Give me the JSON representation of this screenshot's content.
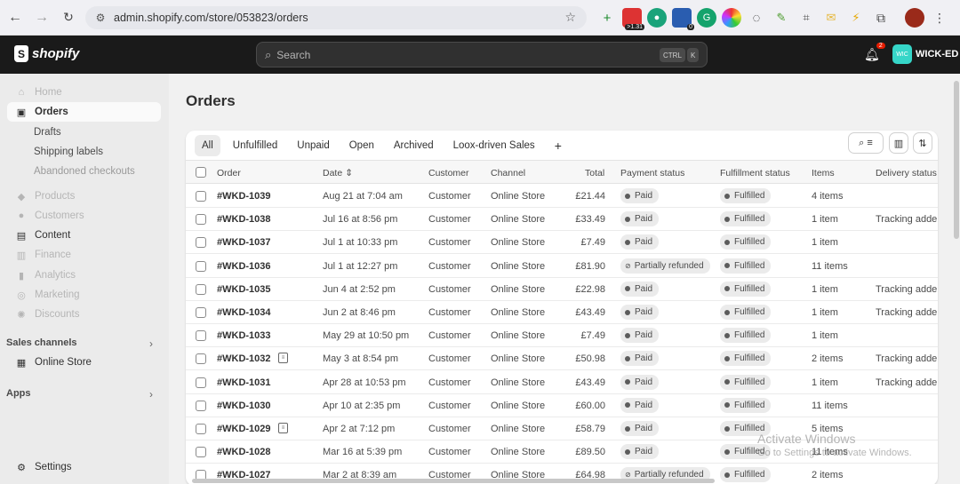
{
  "browser": {
    "url": "admin.shopify.com/store/053823/orders",
    "ext_badge_1": ">1.31",
    "ext_badge_2": "0"
  },
  "topbar": {
    "brand": "shopify",
    "search_placeholder": "Search",
    "kbd_ctrl": "CTRL",
    "kbd_k": "K",
    "notification_count": "2",
    "store_initials": "WIC",
    "store_name": "WICK-ED"
  },
  "sidebar": {
    "home": "Home",
    "orders": "Orders",
    "drafts": "Drafts",
    "shipping_labels": "Shipping labels",
    "abandoned_checkouts": "Abandoned checkouts",
    "products": "Products",
    "customers": "Customers",
    "content": "Content",
    "finance": "Finance",
    "analytics": "Analytics",
    "marketing": "Marketing",
    "discounts": "Discounts",
    "sales_channels": "Sales channels",
    "online_store": "Online Store",
    "apps": "Apps",
    "settings": "Settings"
  },
  "page": {
    "title": "Orders",
    "tabs": [
      "All",
      "Unfulfilled",
      "Unpaid",
      "Open",
      "Archived",
      "Loox-driven Sales"
    ],
    "add_tab": "+"
  },
  "table": {
    "headers": {
      "order": "Order",
      "date": "Date",
      "customer": "Customer",
      "channel": "Channel",
      "total": "Total",
      "payment": "Payment status",
      "fulfillment": "Fulfillment status",
      "items": "Items",
      "delivery": "Delivery status"
    },
    "rows": [
      {
        "order": "#WKD-1039",
        "date": "Aug 21 at 7:04 am",
        "customer": "Customer",
        "channel": "Online Store",
        "total": "£21.44",
        "payment": "Paid",
        "fulfillment": "Fulfilled",
        "items": "4 items",
        "delivery": "",
        "note": false
      },
      {
        "order": "#WKD-1038",
        "date": "Jul 16 at 8:56 pm",
        "customer": "Customer",
        "channel": "Online Store",
        "total": "£33.49",
        "payment": "Paid",
        "fulfillment": "Fulfilled",
        "items": "1 item",
        "delivery": "Tracking adde",
        "note": false
      },
      {
        "order": "#WKD-1037",
        "date": "Jul 1 at 10:33 pm",
        "customer": "Customer",
        "channel": "Online Store",
        "total": "£7.49",
        "payment": "Paid",
        "fulfillment": "Fulfilled",
        "items": "1 item",
        "delivery": "",
        "note": false
      },
      {
        "order": "#WKD-1036",
        "date": "Jul 1 at 12:27 pm",
        "customer": "Customer",
        "channel": "Online Store",
        "total": "£81.90",
        "payment": "Partially refunded",
        "fulfillment": "Fulfilled",
        "items": "11 items",
        "delivery": "",
        "note": false
      },
      {
        "order": "#WKD-1035",
        "date": "Jun 4 at 2:52 pm",
        "customer": "Customer",
        "channel": "Online Store",
        "total": "£22.98",
        "payment": "Paid",
        "fulfillment": "Fulfilled",
        "items": "1 item",
        "delivery": "Tracking adde",
        "note": false
      },
      {
        "order": "#WKD-1034",
        "date": "Jun 2 at 8:46 pm",
        "customer": "Customer",
        "channel": "Online Store",
        "total": "£43.49",
        "payment": "Paid",
        "fulfillment": "Fulfilled",
        "items": "1 item",
        "delivery": "Tracking adde",
        "note": false
      },
      {
        "order": "#WKD-1033",
        "date": "May 29 at 10:50 pm",
        "customer": "Customer",
        "channel": "Online Store",
        "total": "£7.49",
        "payment": "Paid",
        "fulfillment": "Fulfilled",
        "items": "1 item",
        "delivery": "",
        "note": false
      },
      {
        "order": "#WKD-1032",
        "date": "May 3 at 8:54 pm",
        "customer": "Customer",
        "channel": "Online Store",
        "total": "£50.98",
        "payment": "Paid",
        "fulfillment": "Fulfilled",
        "items": "2 items",
        "delivery": "Tracking adde",
        "note": true
      },
      {
        "order": "#WKD-1031",
        "date": "Apr 28 at 10:53 pm",
        "customer": "Customer",
        "channel": "Online Store",
        "total": "£43.49",
        "payment": "Paid",
        "fulfillment": "Fulfilled",
        "items": "1 item",
        "delivery": "Tracking adde",
        "note": false
      },
      {
        "order": "#WKD-1030",
        "date": "Apr 10 at 2:35 pm",
        "customer": "Customer",
        "channel": "Online Store",
        "total": "£60.00",
        "payment": "Paid",
        "fulfillment": "Fulfilled",
        "items": "11 items",
        "delivery": "",
        "note": false
      },
      {
        "order": "#WKD-1029",
        "date": "Apr 2 at 7:12 pm",
        "customer": "Customer",
        "channel": "Online Store",
        "total": "£58.79",
        "payment": "Paid",
        "fulfillment": "Fulfilled",
        "items": "5 items",
        "delivery": "",
        "note": true
      },
      {
        "order": "#WKD-1028",
        "date": "Mar 16 at 5:39 pm",
        "customer": "Customer",
        "channel": "Online Store",
        "total": "£89.50",
        "payment": "Paid",
        "fulfillment": "Fulfilled",
        "items": "11 items",
        "delivery": "",
        "note": false
      },
      {
        "order": "#WKD-1027",
        "date": "Mar 2 at 8:39 am",
        "customer": "Customer",
        "channel": "Online Store",
        "total": "£64.98",
        "payment": "Partially refunded",
        "fulfillment": "Fulfilled",
        "items": "2 items",
        "delivery": "",
        "note": false
      }
    ]
  },
  "watermark": {
    "line1": "Activate Windows",
    "line2": "Go to Settings to activate Windows."
  },
  "colors": {
    "topbar": "#1a1a1a",
    "sidebar": "#ebebeb",
    "accent_avatar": "#36d6c8",
    "notification": "#e51c00"
  }
}
